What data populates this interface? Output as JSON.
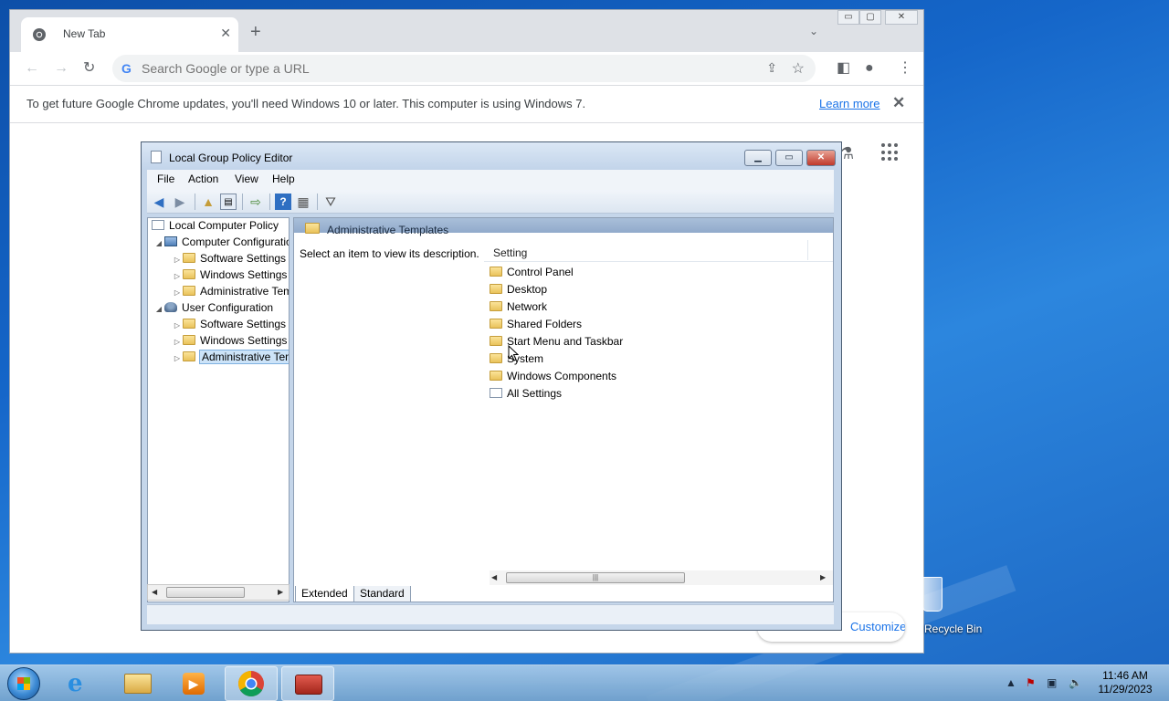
{
  "browser": {
    "tab_title": "New Tab",
    "tab_close": "✕",
    "new_tab": "+",
    "tab_menu": "⌄",
    "omnibox_placeholder": "Search Google or type a URL",
    "infobar_message": "To get future Google Chrome updates, you'll need Windows 10 or later. This computer is using Windows 7.",
    "infobar_link": "Learn more",
    "customize_label": "Customize Chrome",
    "window_buttons": [
      "▭",
      "▢",
      "✕"
    ]
  },
  "gpedit": {
    "title": "Local Group Policy Editor",
    "menu": [
      "File",
      "Action",
      "View",
      "Help"
    ],
    "tree": [
      {
        "label": "Local Computer Policy",
        "toggle": "",
        "icon": "policy-icon"
      },
      {
        "label": "Computer Configuration",
        "toggle": "◢",
        "icon": "computer-icon"
      },
      {
        "label": "Software Settings",
        "toggle": "▷",
        "icon": "folder-icon"
      },
      {
        "label": "Windows Settings",
        "toggle": "▷",
        "icon": "folder-icon"
      },
      {
        "label": "Administrative Templates",
        "toggle": "▷",
        "icon": "folder-icon"
      },
      {
        "label": "User Configuration",
        "toggle": "◢",
        "icon": "user-icon"
      },
      {
        "label": "Software Settings",
        "toggle": "▷",
        "icon": "folder-icon"
      },
      {
        "label": "Windows Settings",
        "toggle": "▷",
        "icon": "folder-icon"
      },
      {
        "label": "Administrative Templates",
        "toggle": "▷",
        "icon": "folder-icon",
        "selected": true
      }
    ],
    "pane_header": "Administrative Templates",
    "description": "Select an item to view its description.",
    "column_header": "Setting",
    "items": [
      {
        "label": "Control Panel",
        "icon": "folder-icon"
      },
      {
        "label": "Desktop",
        "icon": "folder-icon"
      },
      {
        "label": "Network",
        "icon": "folder-icon"
      },
      {
        "label": "Shared Folders",
        "icon": "folder-icon"
      },
      {
        "label": "Start Menu and Taskbar",
        "icon": "folder-icon"
      },
      {
        "label": "System",
        "icon": "folder-icon"
      },
      {
        "label": "Windows Components",
        "icon": "folder-icon"
      },
      {
        "label": "All Settings",
        "icon": "all-settings-icon"
      }
    ],
    "view_tabs": [
      "Extended",
      "Standard"
    ]
  },
  "desktop": {
    "recycle_bin_label": "Recycle Bin"
  },
  "taskbar": {
    "time": "11:46 AM",
    "date": "11/29/2023"
  },
  "colors": {
    "chrome_link": "#1a73e8",
    "selection": "#cce3f8",
    "desktop": "#1566c9"
  }
}
